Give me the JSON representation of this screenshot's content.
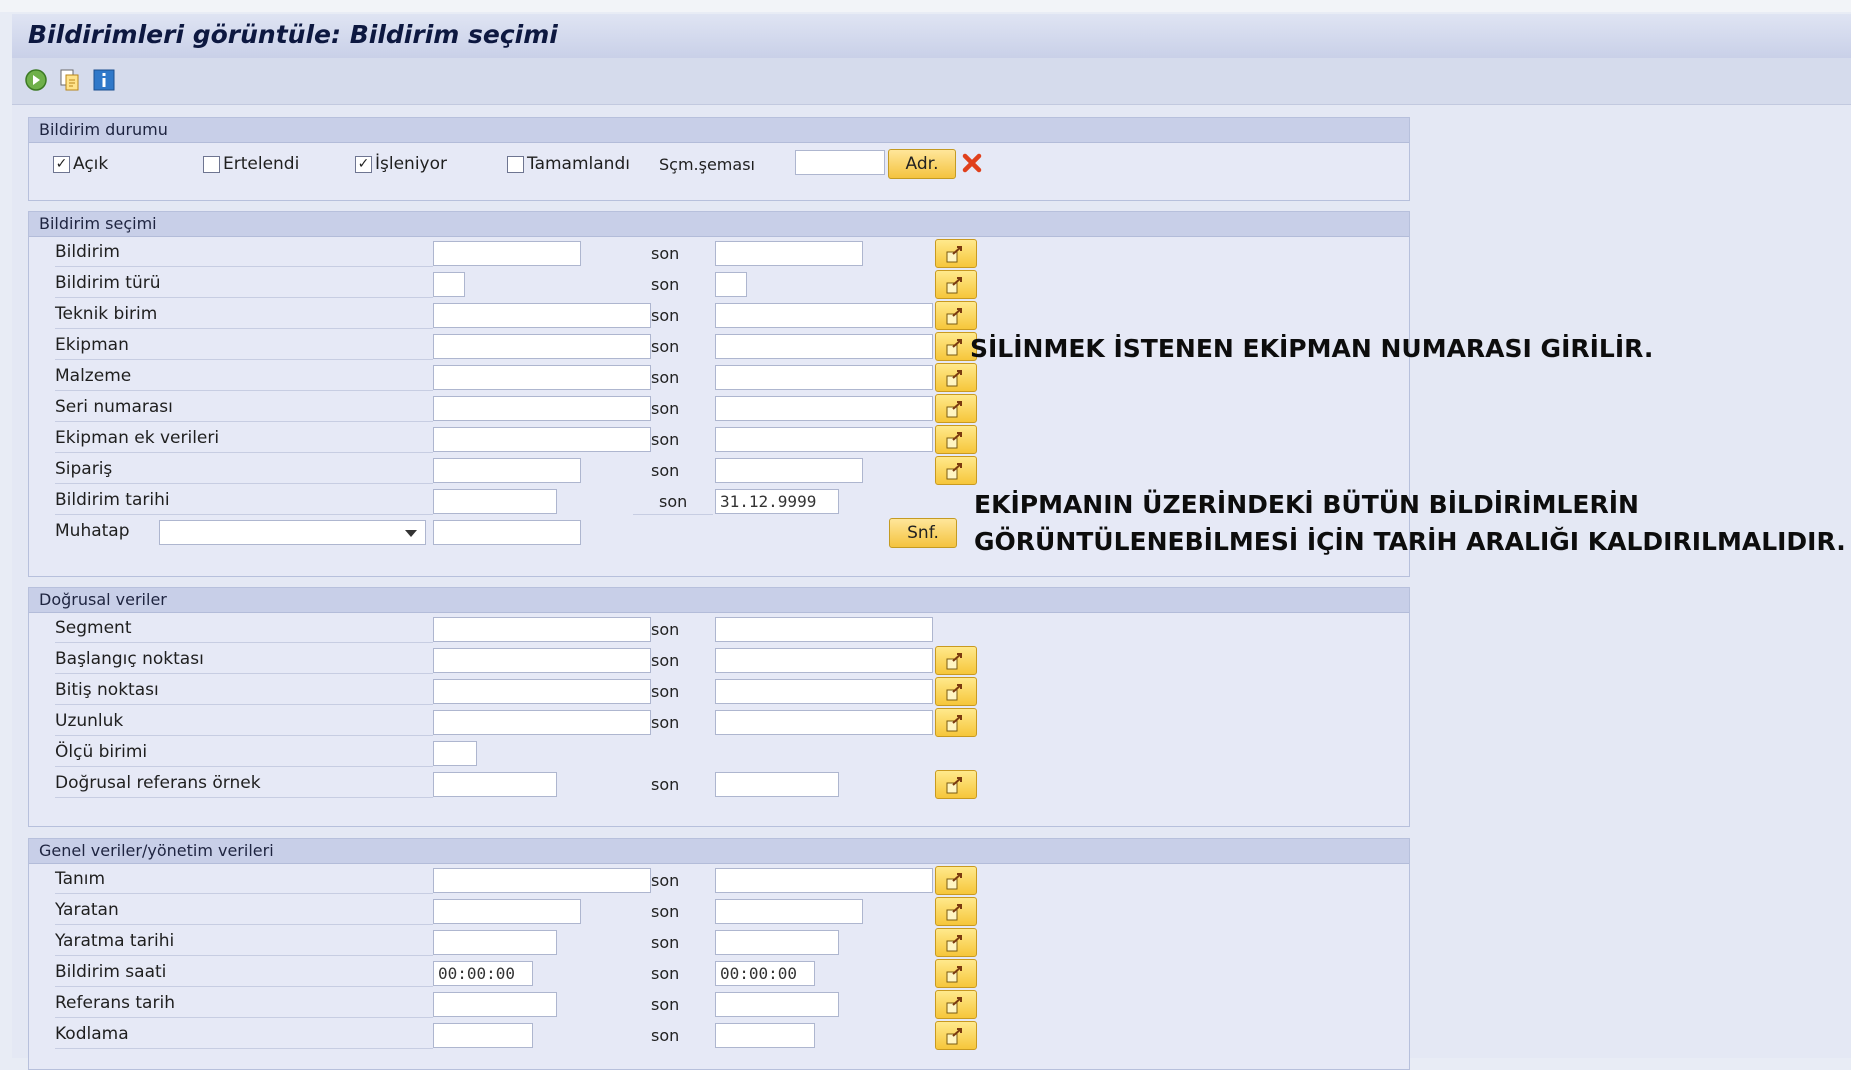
{
  "window": {
    "title": "Bildirimleri görüntüle: Bildirim seçimi"
  },
  "toolbar": {
    "icons": [
      "execute-icon",
      "copy-variant-icon",
      "info-icon"
    ]
  },
  "status_group": {
    "title": "Bildirim durumu",
    "checkboxes": [
      {
        "label": "Açık",
        "checked": true
      },
      {
        "label": "Ertelendi",
        "checked": false
      },
      {
        "label": "İşleniyor",
        "checked": true
      },
      {
        "label": "Tamamlandı",
        "checked": false
      }
    ],
    "scheme_label": "Sçm.şeması",
    "scheme_value": "",
    "adr_button": "Adr."
  },
  "selection_group": {
    "title": "Bildirim seçimi",
    "son": "son",
    "rows": [
      {
        "label": "Bildirim",
        "from": "",
        "to": ""
      },
      {
        "label": "Bildirim türü",
        "from": "",
        "to": ""
      },
      {
        "label": "Teknik birim",
        "from": "",
        "to": ""
      },
      {
        "label": "Ekipman",
        "from": "",
        "to": ""
      },
      {
        "label": "Malzeme",
        "from": "",
        "to": ""
      },
      {
        "label": "Seri numarası",
        "from": "",
        "to": ""
      },
      {
        "label": "Ekipman ek verileri",
        "from": "",
        "to": ""
      },
      {
        "label": "Sipariş",
        "from": "",
        "to": ""
      },
      {
        "label": "Bildirim tarihi",
        "from": "",
        "to": "31.12.9999"
      },
      {
        "label": "Muhatap",
        "from": "",
        "to": ""
      }
    ],
    "snf_button": "Snf."
  },
  "linear_group": {
    "title": "Doğrusal veriler",
    "rows": [
      {
        "label": "Segment",
        "from": "",
        "to": ""
      },
      {
        "label": "Başlangıç noktası",
        "from": "",
        "to": ""
      },
      {
        "label": "Bitiş noktası",
        "from": "",
        "to": ""
      },
      {
        "label": "Uzunluk",
        "from": "",
        "to": ""
      },
      {
        "label": "Ölçü birimi",
        "from": ""
      },
      {
        "label": "Doğrusal referans örnek",
        "from": "",
        "to": ""
      }
    ]
  },
  "general_group": {
    "title": "Genel veriler/yönetim verileri",
    "rows": [
      {
        "label": "Tanım",
        "from": "",
        "to": ""
      },
      {
        "label": "Yaratan",
        "from": "",
        "to": ""
      },
      {
        "label": "Yaratma tarihi",
        "from": "",
        "to": ""
      },
      {
        "label": "Bildirim saati",
        "from": "00:00:00",
        "to": "00:00:00"
      },
      {
        "label": "Referans tarih",
        "from": "",
        "to": ""
      },
      {
        "label": "Kodlama",
        "from": "",
        "to": ""
      }
    ]
  },
  "annotations": {
    "equipment_note": "SİLİNMEK İSTENEN EKİPMAN NUMARASI GİRİLİR.",
    "date_note_line1": "EKİPMANIN ÜZERİNDEKİ BÜTÜN BİLDİRİMLERİN",
    "date_note_line2": "GÖRÜNTÜLENEBİLMESİ İÇİN TARİH ARALIĞI KALDIRILMALIDIR."
  },
  "colors": {
    "accent_button": "#f4c33f",
    "delete_icon": "#e0401c",
    "title_text": "#0d1840"
  }
}
